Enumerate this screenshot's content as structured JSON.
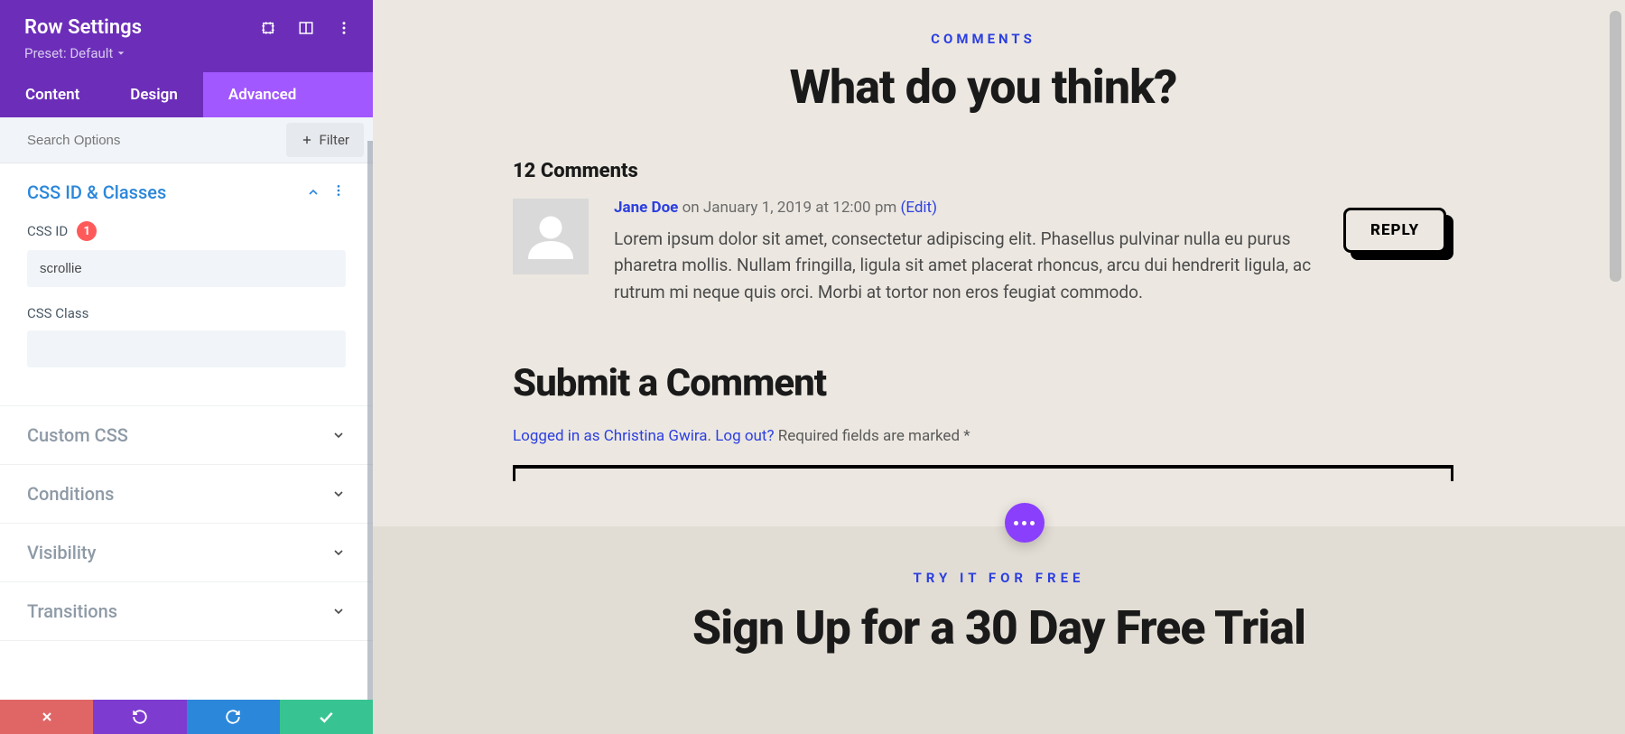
{
  "sidebar": {
    "title": "Row Settings",
    "preset": "Preset: Default",
    "tabs": {
      "content": "Content",
      "design": "Design",
      "advanced": "Advanced"
    },
    "search_placeholder": "Search Options",
    "filter_label": "Filter",
    "sections": {
      "css_id_classes": {
        "title": "CSS ID & Classes",
        "css_id_label": "CSS ID",
        "css_id_badge": "1",
        "css_id_value": "scrollie",
        "css_class_label": "CSS Class",
        "css_class_value": ""
      },
      "custom_css": "Custom CSS",
      "conditions": "Conditions",
      "visibility": "Visibility",
      "transitions": "Transitions"
    }
  },
  "preview": {
    "eyebrow": "COMMENTS",
    "heading": "What do you think?",
    "comments_count": "12 Comments",
    "comment": {
      "author": "Jane Doe",
      "date_prefix": "on ",
      "date": "January 1, 2019 at 12:00 pm",
      "edit": "(Edit)",
      "text": "Lorem ipsum dolor sit amet, consectetur adipiscing elit. Phasellus pulvinar nulla eu purus pharetra mollis. Nullam fringilla, ligula sit amet placerat rhoncus, arcu dui hendrerit ligula, ac rutrum mi neque quis orci. Morbi at tortor non eros feugiat commodo.",
      "reply": "REPLY"
    },
    "submit": {
      "heading": "Submit a Comment",
      "logged_in": "Logged in as Christina Gwira",
      "logout": "Log out?",
      "required": " Required fields are marked *"
    },
    "trial": {
      "eyebrow": "TRY IT FOR FREE",
      "heading": "Sign Up for a 30 Day Free Trial"
    }
  }
}
